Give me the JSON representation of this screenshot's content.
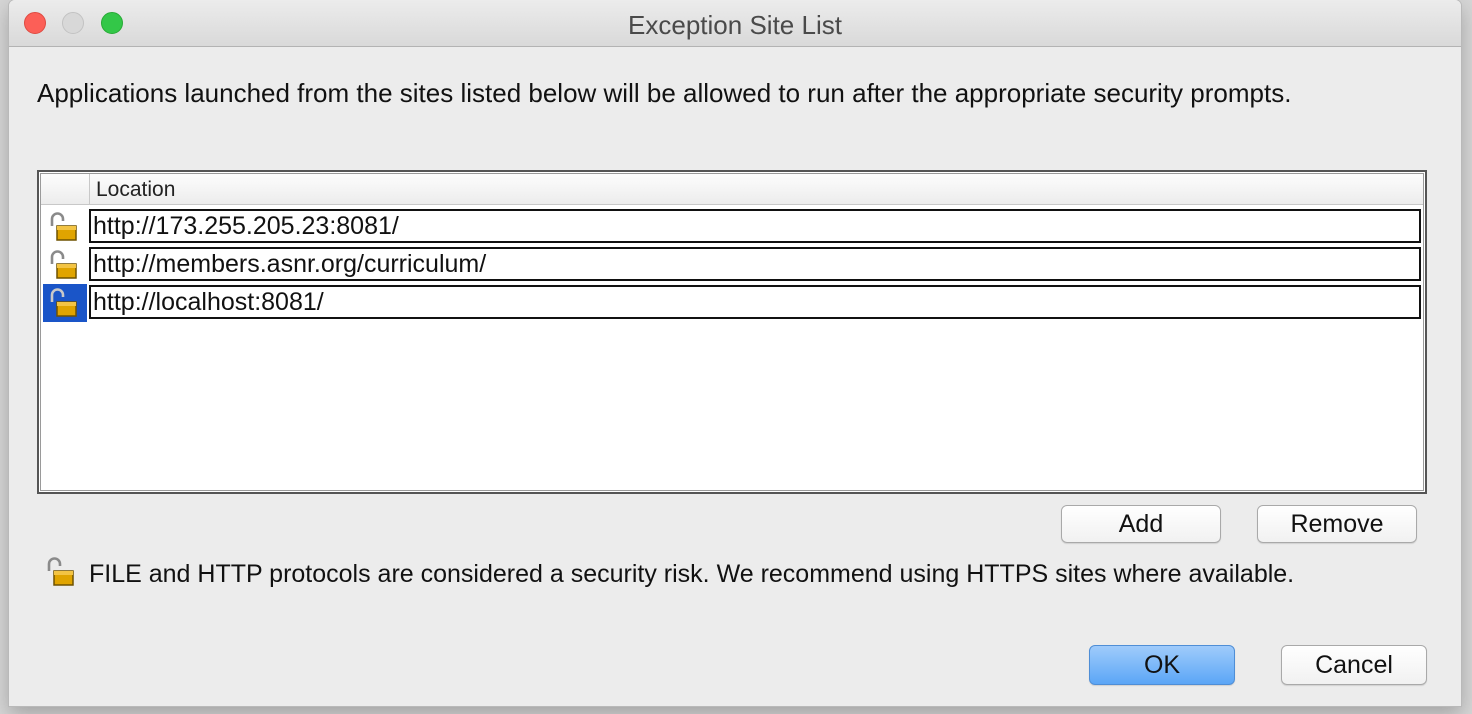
{
  "window": {
    "title": "Exception Site List"
  },
  "intro_text": "Applications launched from the sites listed below will be allowed to run after the appropriate security prompts.",
  "table": {
    "column_header": "Location",
    "rows": [
      {
        "location": "http://173.255.205.23:8081/",
        "icon": "unlocked-padlock-icon",
        "selected": false
      },
      {
        "location": "http://members.asnr.org/curriculum/",
        "icon": "unlocked-padlock-icon",
        "selected": false
      },
      {
        "location": "http://localhost:8081/",
        "icon": "unlocked-padlock-icon",
        "selected": true
      }
    ]
  },
  "buttons": {
    "add": "Add",
    "remove": "Remove",
    "ok": "OK",
    "cancel": "Cancel"
  },
  "warning": {
    "icon": "unlocked-padlock-icon",
    "text": "FILE and HTTP protocols are considered a security risk.  We recommend using HTTPS sites where available."
  },
  "colors": {
    "selection": "#1a55c8",
    "default_button": "#5ba6f6",
    "close": "#fc5f57",
    "maximize": "#33c748"
  }
}
